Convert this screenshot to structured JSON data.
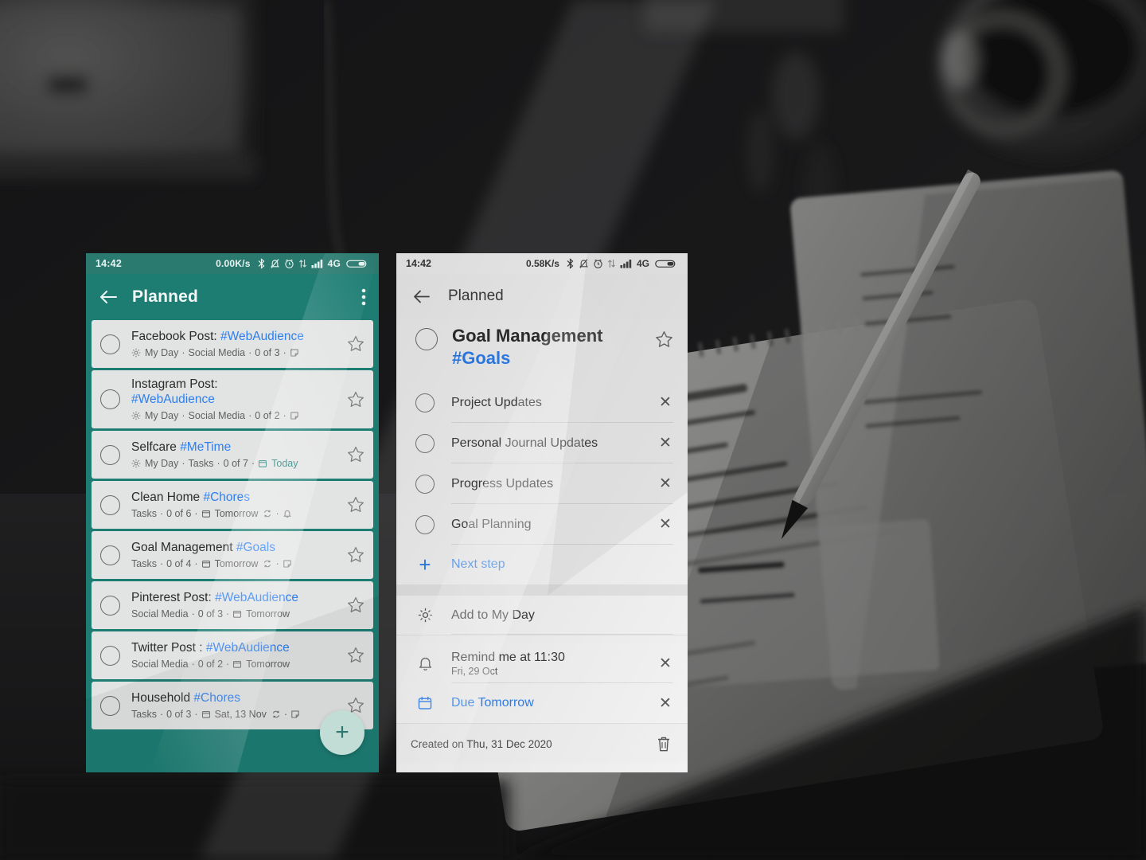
{
  "left_phone": {
    "status_bar": {
      "time": "14:42",
      "network_speed": "0.00K/s",
      "network_type": "4G",
      "icons": [
        "bluetooth-icon",
        "mute-bell-icon",
        "alarm-clock-icon",
        "data-transfer-icon",
        "signal-bars-icon",
        "battery-icon"
      ]
    },
    "appbar": {
      "back_label": "back-arrow-icon",
      "title": "Planned",
      "overflow_label": "more-options-icon"
    },
    "tasks": [
      {
        "title": "Facebook Post:",
        "tag": "#WebAudience",
        "title_wraps": false,
        "my_day": true,
        "list": "Social Media",
        "progress": "0 of 3",
        "due": "",
        "due_today": false,
        "has_note": true,
        "has_repeat": false
      },
      {
        "title": "Instagram Post:",
        "tag": "#WebAudience",
        "title_wraps": true,
        "my_day": true,
        "list": "Social Media",
        "progress": "0 of 2",
        "due": "",
        "due_today": false,
        "has_note": true,
        "has_repeat": false
      },
      {
        "title": "Selfcare",
        "tag": "#MeTime",
        "title_wraps": false,
        "my_day": true,
        "list": "Tasks",
        "progress": "0 of 7",
        "due": "Today",
        "due_today": true,
        "has_note": false,
        "has_repeat": false
      },
      {
        "title": "Clean Home",
        "tag": "#Chores",
        "title_wraps": false,
        "my_day": false,
        "list": "Tasks",
        "progress": "0 of 6",
        "due": "Tomorrow",
        "due_today": false,
        "has_note": false,
        "has_repeat": true,
        "has_reminder": true
      },
      {
        "title": "Goal Management",
        "tag": "#Goals",
        "title_wraps": false,
        "my_day": false,
        "list": "Tasks",
        "progress": "0 of 4",
        "due": "Tomorrow",
        "due_today": false,
        "has_note": true,
        "has_repeat": true
      },
      {
        "title": "Pinterest Post:",
        "tag": "#WebAudience",
        "title_wraps": false,
        "my_day": false,
        "list": "Social Media",
        "progress": "0 of 3",
        "due": "Tomorrow",
        "due_today": false,
        "has_note": false,
        "has_repeat": false
      },
      {
        "title": "Twitter Post :",
        "tag": "#WebAudience",
        "title_wraps": false,
        "my_day": false,
        "list": "Social Media",
        "progress": "0 of 2",
        "due": "Tomorrow",
        "due_today": false,
        "has_note": false,
        "has_repeat": false
      },
      {
        "title": "Household",
        "tag": "#Chores",
        "title_wraps": false,
        "my_day": false,
        "list": "Tasks",
        "progress": "0 of 3",
        "due": "Sat, 13 Nov",
        "due_today": false,
        "has_note": true,
        "has_repeat": true
      }
    ],
    "fab_label": "+"
  },
  "right_phone": {
    "status_bar": {
      "time": "14:42",
      "network_speed": "0.58K/s",
      "network_type": "4G"
    },
    "appbar": {
      "title": "Planned"
    },
    "detail": {
      "title": "Goal Management",
      "tag": "#Goals",
      "steps": [
        {
          "label": "Project Updates"
        },
        {
          "label": "Personal Journal Updates"
        },
        {
          "label": "Progress Updates"
        },
        {
          "label": "Goal Planning"
        }
      ],
      "next_step_label": "Next step",
      "options": [
        {
          "name": "add-to-my-day",
          "icon": "sun-icon",
          "label": "Add to My Day",
          "sub": "",
          "link": false,
          "removable": false
        },
        {
          "name": "reminder",
          "icon": "bell-icon",
          "label": "Remind me at 11:30",
          "sub": "Fri, 29 Oct",
          "link": false,
          "removable": true
        },
        {
          "name": "due-date",
          "icon": "calendar-icon",
          "label": "Due Tomorrow",
          "sub": "",
          "link": true,
          "removable": true
        }
      ],
      "created_text": "Created on Thu, 31 Dec 2020",
      "delete_label": "trash-icon"
    }
  },
  "colors": {
    "teal": "#1d7d73",
    "teal_dark": "#2a7a70",
    "link_blue": "#2d7ff0",
    "fab_bg": "#cce9e2",
    "card_bg": "#e2e3e3"
  }
}
